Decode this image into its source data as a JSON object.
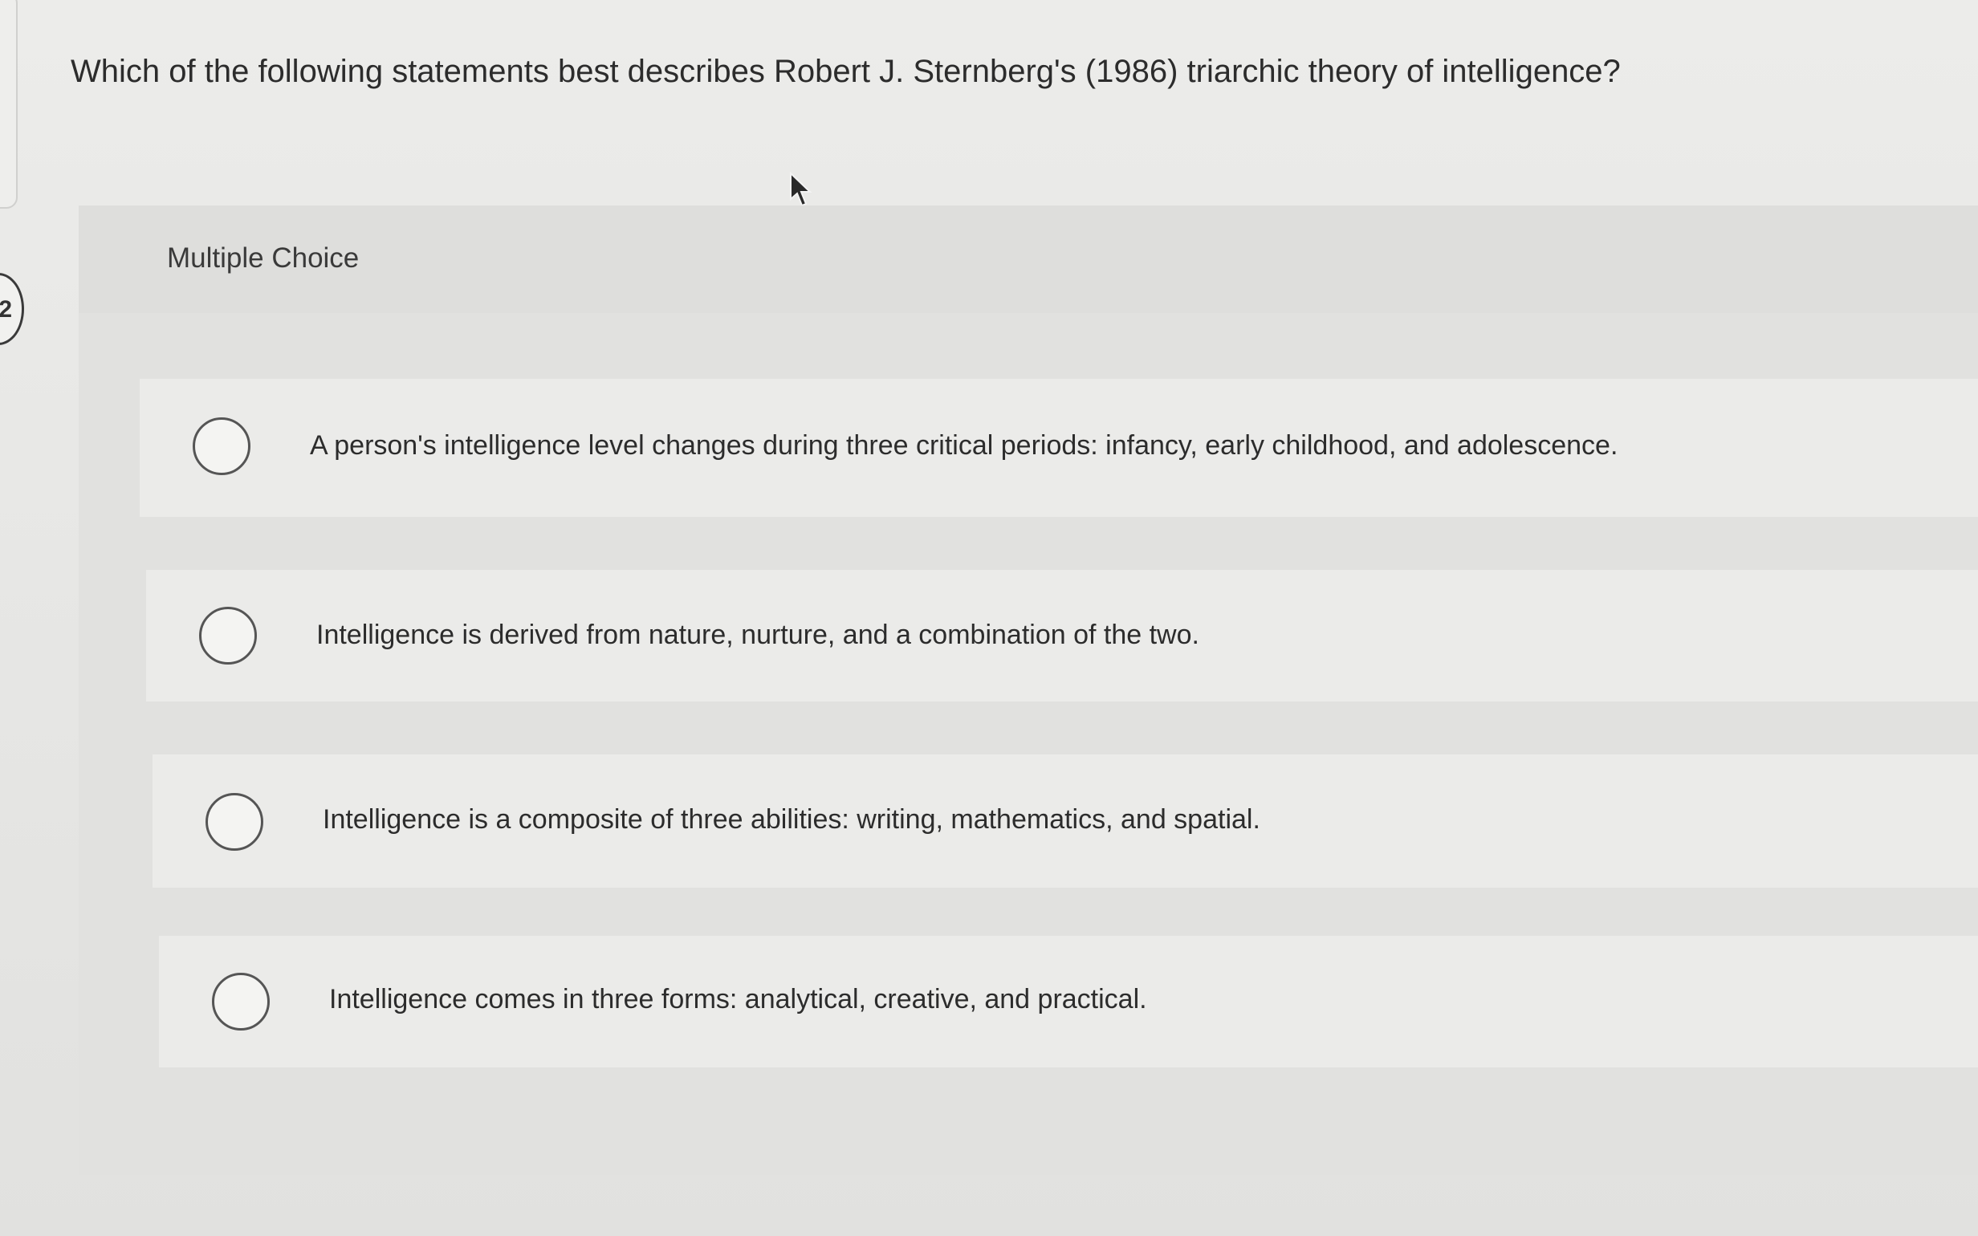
{
  "question": {
    "number": "2",
    "text": "Which of the following statements best describes Robert J. Sternberg's (1986) triarchic theory of intelligence?"
  },
  "section": {
    "label": "Multiple Choice"
  },
  "options": [
    {
      "text": "A person's intelligence level changes during three critical periods: infancy, early childhood, and adolescence.",
      "selected": false
    },
    {
      "text": "Intelligence is derived from nature, nurture, and a combination of the two.",
      "selected": false
    },
    {
      "text": "Intelligence is a composite of three abilities: writing, mathematics, and spatial.",
      "selected": false
    },
    {
      "text": "Intelligence comes in three forms: analytical, creative, and practical.",
      "selected": false
    }
  ],
  "icons": {
    "cursor": "mouse-pointer-icon",
    "radio": "radio-button-icon"
  }
}
